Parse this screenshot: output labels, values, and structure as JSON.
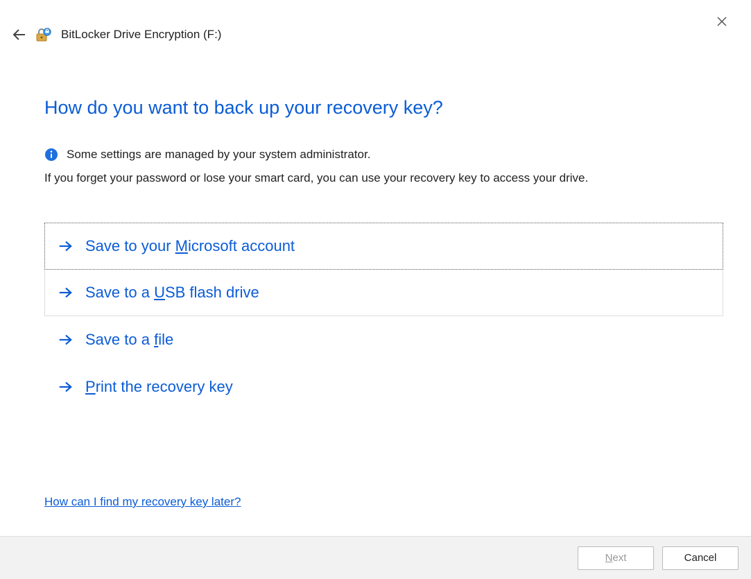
{
  "window": {
    "title": "BitLocker Drive Encryption (F:)",
    "close_label": "Close"
  },
  "page": {
    "heading": "How do you want to back up your recovery key?",
    "admin_notice": "Some settings are managed by your system administrator.",
    "explanation": "If you forget your password or lose your smart card, you can use your recovery key to access your drive.",
    "help_link": "How can I find my recovery key later?"
  },
  "options": [
    {
      "prefix": "Save to your ",
      "mnemonic": "M",
      "suffix": "icrosoft account"
    },
    {
      "prefix": "Save to a ",
      "mnemonic": "U",
      "suffix": "SB flash drive"
    },
    {
      "prefix": "Save to a ",
      "mnemonic": "f",
      "suffix": "ile"
    },
    {
      "prefix": "",
      "mnemonic": "P",
      "suffix": "rint the recovery key"
    }
  ],
  "buttons": {
    "next_mnemonic": "N",
    "next_suffix": "ext",
    "cancel": "Cancel"
  }
}
